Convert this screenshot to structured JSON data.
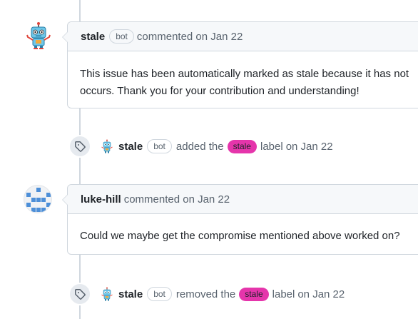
{
  "colors": {
    "label_stale": "#e535ab",
    "label_text": "#1f2328"
  },
  "comments": [
    {
      "author": "stale",
      "badge": "bot",
      "meta": "commented on Jan 22",
      "body_lines": [
        "This issue has been automatically marked as stale because it has not",
        "occurs. Thank you for your contribution and understanding!"
      ],
      "avatar_icon": "robot-icon"
    },
    {
      "author": "luke-hill",
      "meta": "commented on Jan 22",
      "body_lines": [
        "Could we maybe get the compromise mentioned above worked on?"
      ],
      "avatar_icon": "identicon-icon"
    }
  ],
  "events": [
    {
      "author": "stale",
      "badge": "bot",
      "action": "added the",
      "label": "stale",
      "suffix": "label",
      "date": "on Jan 22",
      "icon": "tag-icon"
    },
    {
      "author": "stale",
      "badge": "bot",
      "action": "removed the",
      "label": "stale",
      "suffix": "label",
      "date": "on Jan 22",
      "icon": "tag-icon"
    }
  ]
}
